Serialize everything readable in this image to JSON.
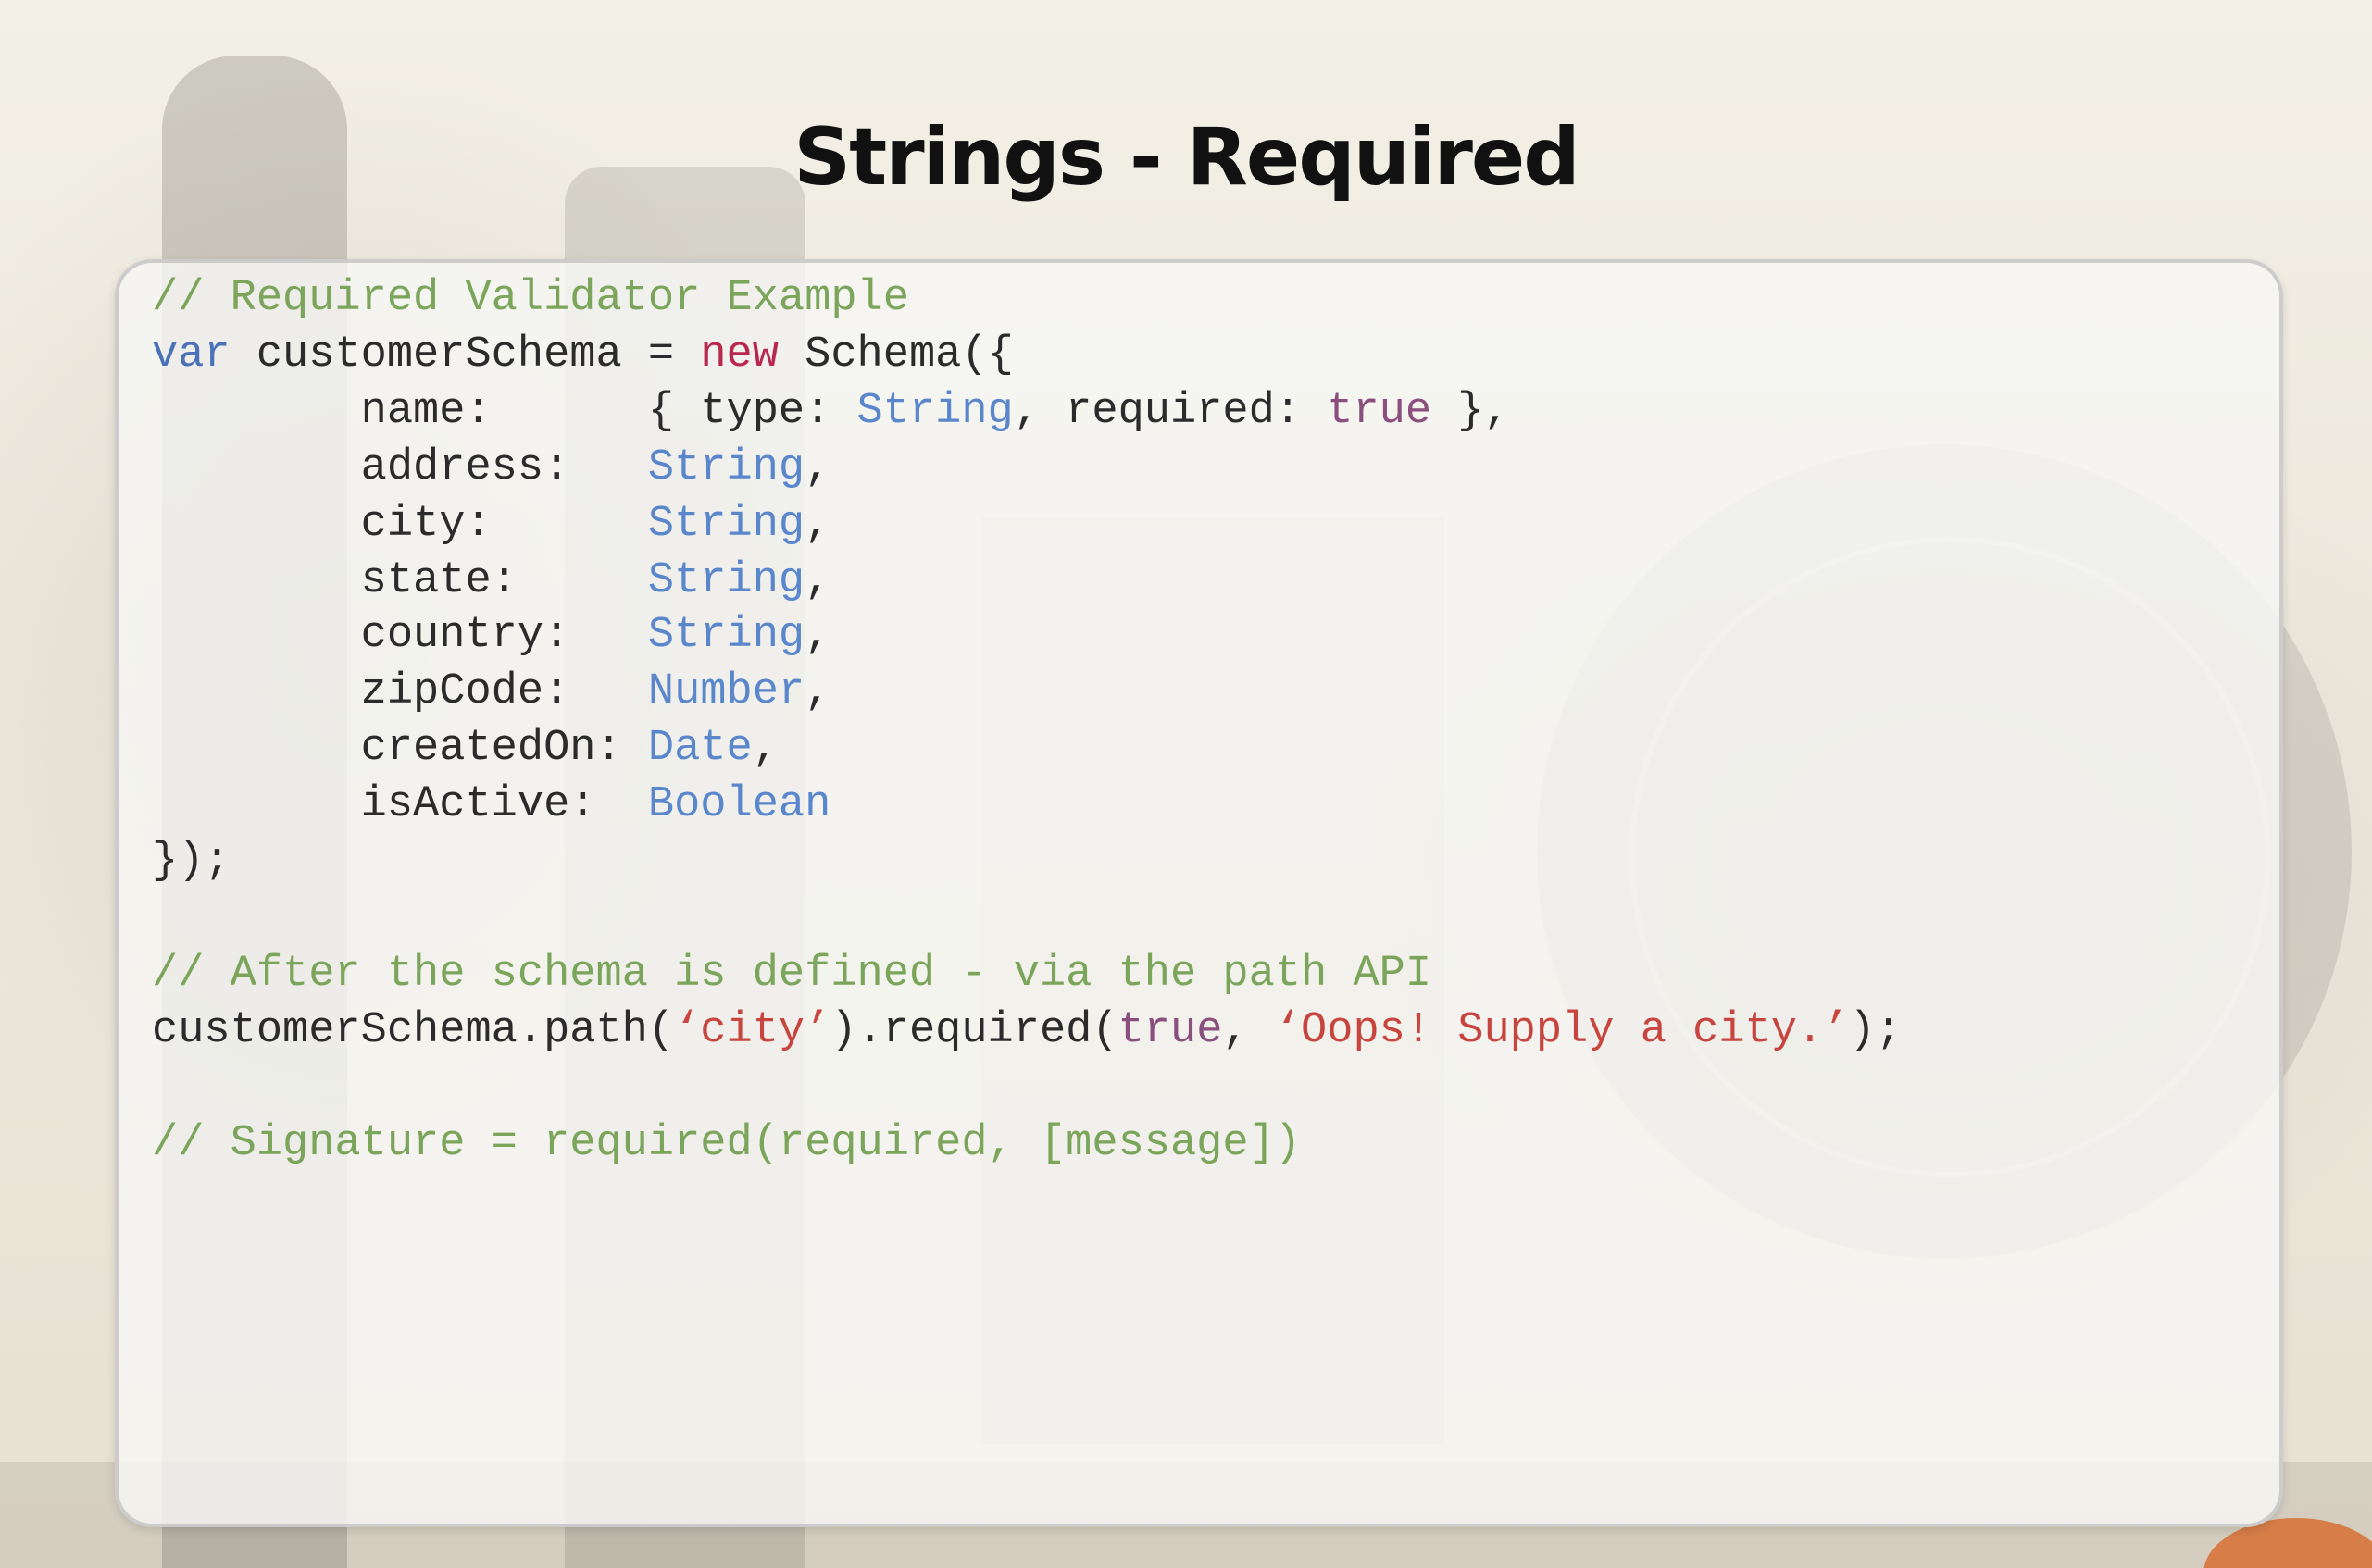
{
  "slide": {
    "title": "Strings - Required"
  },
  "code": {
    "comment1": "// Required Validator Example",
    "line2": {
      "kw_var": "var",
      "decl": " customerSchema = ",
      "kw_new": "new",
      "rest": " Schema({"
    },
    "fields": [
      {
        "name": "        name:      ",
        "pre": "{ type: ",
        "type": "String",
        "mid": ", required: ",
        "flag": "true",
        "post": " },"
      },
      {
        "name": "        address:   ",
        "type": "String",
        "post": ","
      },
      {
        "name": "        city:      ",
        "type": "String",
        "post": ","
      },
      {
        "name": "        state:     ",
        "type": "String",
        "post": ","
      },
      {
        "name": "        country:   ",
        "type": "String",
        "post": ","
      },
      {
        "name": "        zipCode:   ",
        "type": "Number",
        "post": ","
      },
      {
        "name": "        createdOn: ",
        "type": "Date",
        "post": ","
      },
      {
        "name": "        isActive:  ",
        "type": "Boolean",
        "post": ""
      }
    ],
    "close": "});",
    "comment2": "// After the schema is defined - via the path API",
    "path_line": {
      "prefix": "customerSchema.path(",
      "arg": "‘city’",
      "middle": ").required(",
      "flag": "true",
      "comma": ", ",
      "message": "‘Oops! Supply a city.’",
      "suffix": ");"
    },
    "comment3": "// Signature = required(required, [message])"
  },
  "colors": {
    "comment": "#7aa55a",
    "keyword": "#4a72b8",
    "new_keyword": "#b8284e",
    "type": "#5a86cc",
    "boolean": "#8a4f7d",
    "string": "#c8453f",
    "plain": "#2b2b2b"
  }
}
